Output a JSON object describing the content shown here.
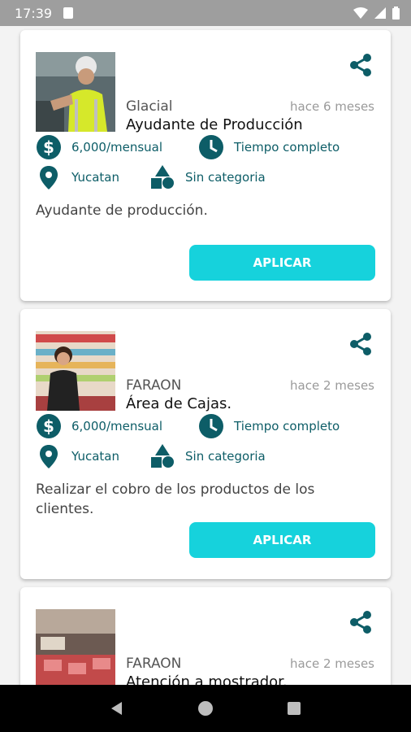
{
  "status_bar": {
    "time": "17:39"
  },
  "colors": {
    "accent": "#16d2dc",
    "icon": "#0d5d67"
  },
  "jobs": [
    {
      "company": "Glacial",
      "posted": "hace 6 meses",
      "title": "Ayudante de Producción",
      "salary": "6,000/mensual",
      "schedule": "Tiempo completo",
      "location": "Yucatan",
      "category": "Sin categoria",
      "description": "Ayudante de producción.",
      "apply_label": "APLICAR"
    },
    {
      "company": "FARAON",
      "posted": "hace 2 meses",
      "title": "Área de Cajas.",
      "salary": "6,000/mensual",
      "schedule": "Tiempo completo",
      "location": "Yucatan",
      "category": "Sin categoria",
      "description": "Realizar el cobro de los productos de los clientes.",
      "apply_label": "APLICAR"
    },
    {
      "company": "FARAON",
      "posted": "hace 2 meses",
      "title": "Atención a mostrador."
    }
  ]
}
